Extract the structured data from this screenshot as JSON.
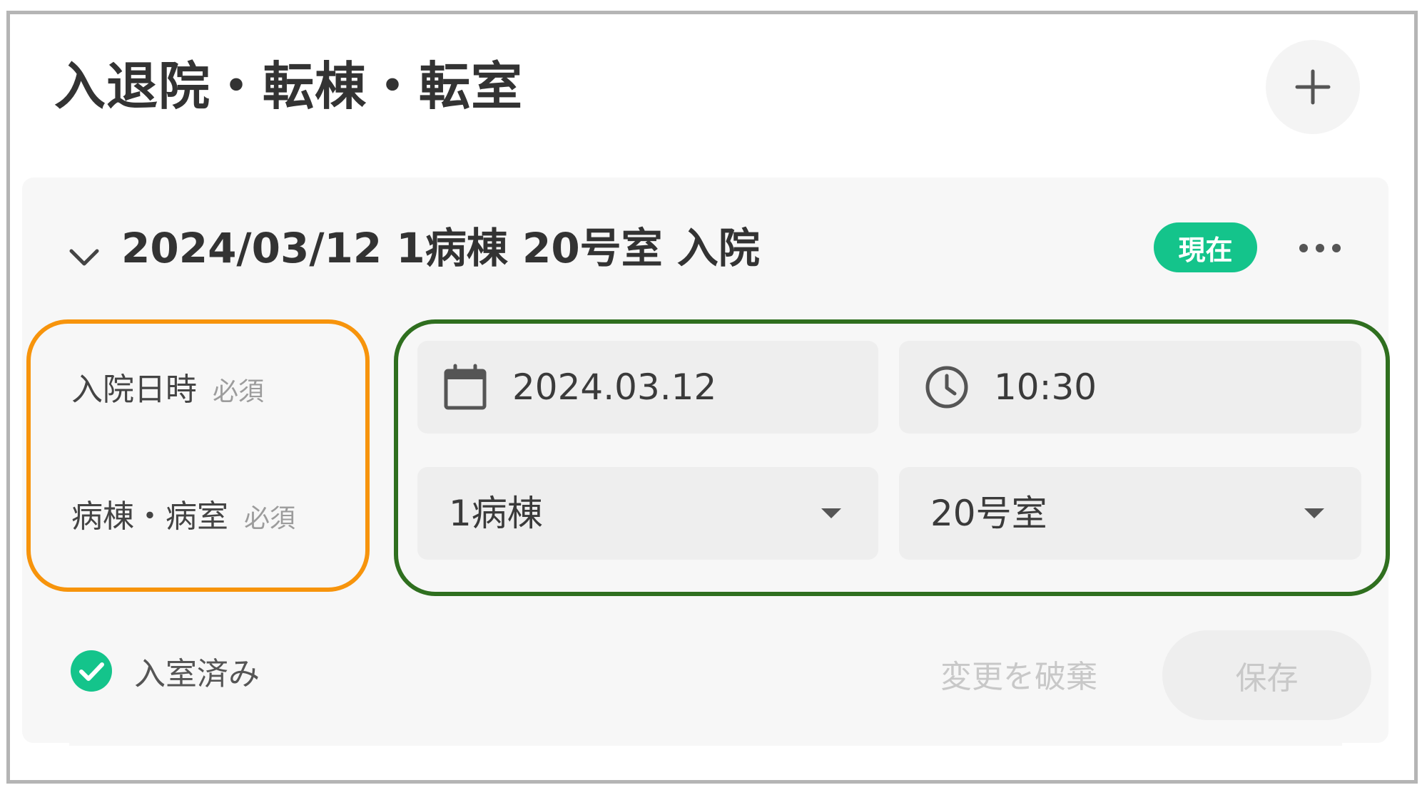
{
  "panel": {
    "title": "入退院・転棟・転室",
    "add_icon": "plus-icon"
  },
  "record": {
    "title": "2024/03/12 1病棟 20号室 入院",
    "collapse_icon": "chevron-down-icon",
    "badge": "現在",
    "more_icon": "more-horizontal-icon"
  },
  "labels": {
    "admission_datetime": "入院日時",
    "ward_room": "病棟・病室",
    "required": "必須"
  },
  "fields": {
    "date": {
      "value": "2024.03.12",
      "icon": "calendar-icon"
    },
    "time": {
      "value": "10:30",
      "icon": "clock-icon"
    },
    "ward": {
      "value": "1病棟",
      "icon": "caret-down-icon"
    },
    "room": {
      "value": "20号室",
      "icon": "caret-down-icon"
    }
  },
  "status": {
    "text": "入室済み",
    "icon": "check-circle-icon"
  },
  "actions": {
    "discard_label": "変更を破棄",
    "save_label": "保存"
  },
  "colors": {
    "accent_green": "#14c48b",
    "highlight_orange": "#f7940c",
    "highlight_green": "#2f6f1f"
  }
}
